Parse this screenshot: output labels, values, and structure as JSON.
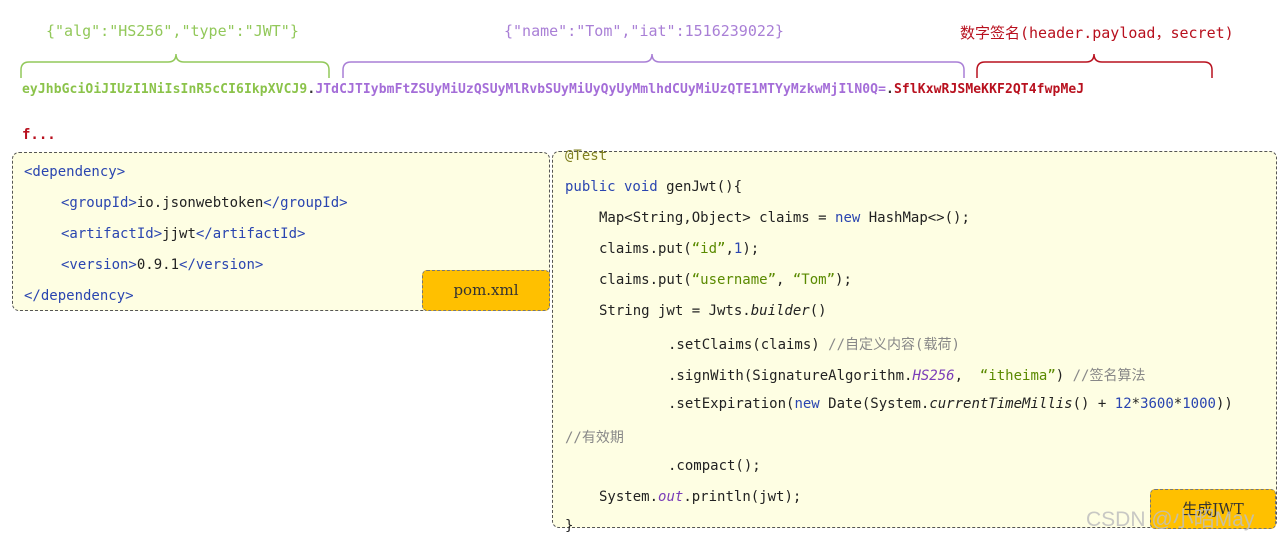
{
  "jwt_structure": {
    "header_annotation": "{\"alg\":\"HS256\",\"type\":\"JWT\"}",
    "payload_annotation": "{\"name\":\"Tom\",\"iat\":1516239022}",
    "signature_annotation": "数字签名(header.payload，secret)",
    "token_header": "eyJhbGciOiJIUzI1NiIsInR5cCI6IkpXVCJ9",
    "token_payload": "JTdCJTIybmFtZSUyMiUzQSUyMlRvbSUyMiUyQyUyMmlhdCUyMiUzQTE1MTYyMzkwMjIlN0Q=",
    "token_signature": "SflKxwRJSMeKKF2QT4fwpMeJ",
    "separator": ".",
    "truncated_line": "f...",
    "colors": {
      "header": "#8bc34a",
      "payload": "#a46dd8",
      "signature": "#b8101e"
    }
  },
  "pom_box": {
    "label": "pom.xml",
    "lines": {
      "l1_open": "<dependency>",
      "l2_open": "<groupId>",
      "l2_val": "io.jsonwebtoken",
      "l2_close": "</groupId>",
      "l3_open": "<artifactId>",
      "l3_val": "jjwt",
      "l3_close": "</artifactId>",
      "l4_open": "<version>",
      "l4_val": "0.9.1",
      "l4_close": "</version>",
      "l5_close": "</dependency>"
    }
  },
  "code_box": {
    "label": "生成JWT",
    "lines": {
      "annotation": "@Test",
      "l1a": "public void ",
      "l1b": "genJwt",
      "l1c": "(){",
      "l2a": "Map<String,Object> claims = ",
      "l2b": "new",
      "l2c": " HashMap<>();",
      "l3a": "claims.put(",
      "l3b": "“id”",
      "l3c": ",",
      "l3d": "1",
      "l3e": ");",
      "l4a": "claims.put(",
      "l4b": "“username”",
      "l4c": ", ",
      "l4d": "“Tom”",
      "l4e": ");",
      "l5a": "String jwt = Jwts.",
      "l5b": "builder",
      "l5c": "()",
      "l6a": ".setClaims(claims) ",
      "l6b": "//自定义内容(载荷)",
      "l7a": ".signWith(SignatureAlgorithm.",
      "l7b": "HS256",
      "l7c": ",  ",
      "l7d": "“itheima”",
      "l7e": ") ",
      "l7f": "//签名算法",
      "l8a": ".setExpiration(",
      "l8b": "new",
      "l8c": " Date(System.",
      "l8d": "currentTimeMillis",
      "l8e": "() + ",
      "l8f": "12",
      "l8g": "*",
      "l8h": "3600",
      "l8i": "*",
      "l8j": "1000",
      "l8k": "))",
      "l9": "//有效期",
      "l10": ".compact();",
      "l11a": "System.",
      "l11b": "out",
      "l11c": ".println(jwt);",
      "l12": "}"
    }
  },
  "watermark": "CSDN @小昭May"
}
